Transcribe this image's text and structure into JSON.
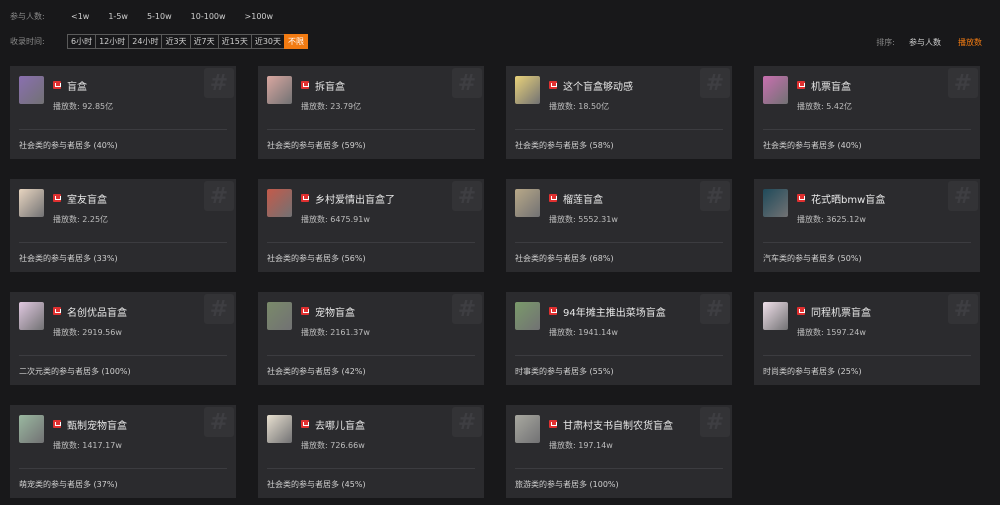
{
  "filters": {
    "participants_label": "参与人数:",
    "participants_options": [
      "<1w",
      "1-5w",
      "5-10w",
      "10-100w",
      ">100w"
    ],
    "time_label": "收录时间:",
    "time_options": [
      "6小时",
      "12小时",
      "24小时",
      "近3天",
      "近7天",
      "近15天",
      "近30天",
      "不限"
    ],
    "time_selected": "不限"
  },
  "sort": {
    "label": "排序:",
    "options": [
      "参与人数",
      "播放数"
    ],
    "selected": "播放数"
  },
  "colors": {
    "accent": "#f27b12",
    "badge": "#e03030",
    "card_bg": "#2b2b2e",
    "page_bg": "#18181a"
  },
  "cards": [
    {
      "title": "盲盒",
      "views": "播放数: 92.85亿",
      "desc": "社会类的参与者居多 (40%)",
      "thumb": "#8a6fb0"
    },
    {
      "title": "拆盲盒",
      "views": "播放数: 23.79亿",
      "desc": "社会类的参与者居多 (59%)",
      "thumb": "#d9a7a0"
    },
    {
      "title": "这个盲盒够动感",
      "views": "播放数: 18.50亿",
      "desc": "社会类的参与者居多 (58%)",
      "thumb": "#e9d27a"
    },
    {
      "title": "机票盲盒",
      "views": "播放数: 5.42亿",
      "desc": "社会类的参与者居多 (40%)",
      "thumb": "#c96fb0"
    },
    {
      "title": "室友盲盒",
      "views": "播放数: 2.25亿",
      "desc": "社会类的参与者居多 (33%)",
      "thumb": "#e8d5c0"
    },
    {
      "title": "乡村爱情出盲盒了",
      "views": "播放数: 6475.91w",
      "desc": "社会类的参与者居多 (56%)",
      "thumb": "#c45a4a"
    },
    {
      "title": "榴莲盲盒",
      "views": "播放数: 5552.31w",
      "desc": "社会类的参与者居多 (68%)",
      "thumb": "#b8a888"
    },
    {
      "title": "花式晒bmw盲盒",
      "views": "播放数: 3625.12w",
      "desc": "汽车类的参与者居多 (50%)",
      "thumb": "#1f4a5a"
    },
    {
      "title": "名创优品盲盒",
      "views": "播放数: 2919.56w",
      "desc": "二次元类的参与者居多 (100%)",
      "thumb": "#e0c8e0"
    },
    {
      "title": "宠物盲盒",
      "views": "播放数: 2161.37w",
      "desc": "社会类的参与者居多 (42%)",
      "thumb": "#7a8a6a"
    },
    {
      "title": "94年摊主推出菜场盲盒",
      "views": "播放数: 1941.14w",
      "desc": "时事类的参与者居多 (55%)",
      "thumb": "#7a9a6a"
    },
    {
      "title": "同程机票盲盒",
      "views": "播放数: 1597.24w",
      "desc": "时尚类的参与者居多 (25%)",
      "thumb": "#f0e0ea"
    },
    {
      "title": "甄制宠物盲盒",
      "views": "播放数: 1417.17w",
      "desc": "萌宠类的参与者居多 (37%)",
      "thumb": "#9ab8a0"
    },
    {
      "title": "去哪儿盲盒",
      "views": "播放数: 726.66w",
      "desc": "社会类的参与者居多 (45%)",
      "thumb": "#e8e0d0"
    },
    {
      "title": "甘肃村支书自制农货盲盒",
      "views": "播放数: 197.14w",
      "desc": "旅游类的参与者居多 (100%)",
      "thumb": "#a8a8a0"
    }
  ]
}
